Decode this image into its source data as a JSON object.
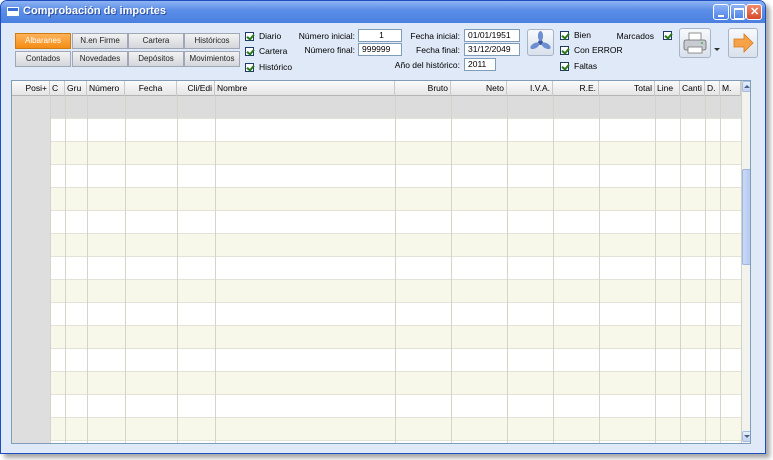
{
  "window": {
    "title": "Comprobación de importes"
  },
  "nav": [
    {
      "label": "Albaranes",
      "name": "nav-albaranes",
      "active": true
    },
    {
      "label": "N.en Firme",
      "name": "nav-en-firme",
      "active": false
    },
    {
      "label": "Cartera",
      "name": "nav-cartera",
      "active": false
    },
    {
      "label": "Históricos",
      "name": "nav-historicos",
      "active": false
    },
    {
      "label": "Contados",
      "name": "nav-contados",
      "active": false
    },
    {
      "label": "Novedades",
      "name": "nav-novedades",
      "active": false
    },
    {
      "label": "Depósitos",
      "name": "nav-depositos",
      "active": false
    },
    {
      "label": "Movimientos",
      "name": "nav-movimientos",
      "active": false
    }
  ],
  "filters": {
    "diario": {
      "label": "Diario",
      "checked": true
    },
    "cartera": {
      "label": "Cartera",
      "checked": true
    },
    "historico": {
      "label": "Histórico",
      "checked": true
    }
  },
  "fields": {
    "numero_inicial": {
      "label": "Número inicial:",
      "value": "1"
    },
    "numero_final": {
      "label": "Número final:",
      "value": "999999"
    },
    "fecha_inicial": {
      "label": "Fecha inicial:",
      "value": "01/01/1951"
    },
    "fecha_final": {
      "label": "Fecha final:",
      "value": "31/12/2049"
    },
    "anio_historico": {
      "label": "Año del histórico:",
      "value": "2011"
    }
  },
  "status_filters": {
    "bien": {
      "label": "Bien",
      "checked": true
    },
    "con_error": {
      "label": "Con ERROR",
      "checked": true
    },
    "faltas": {
      "label": "Faltas",
      "checked": true
    },
    "marcados": {
      "label": "Marcados",
      "checked": true
    }
  },
  "icons": {
    "process": "fan-icon",
    "print": "printer-icon",
    "exit": "exit-arrow-icon"
  },
  "table": {
    "columns": [
      "Posi+",
      "C",
      "Gru",
      "Número",
      "Fecha",
      "Cli/Edi",
      "Nombre",
      "Bruto",
      "Neto",
      "I.V.A.",
      "R.E.",
      "Total",
      "Line",
      "Canti",
      "D.",
      "M."
    ],
    "row_count": 15
  },
  "colors": {
    "active_tab": "#f48d16",
    "row_alt": "#f7f7ea",
    "titlebar": "#4a7fe0"
  }
}
